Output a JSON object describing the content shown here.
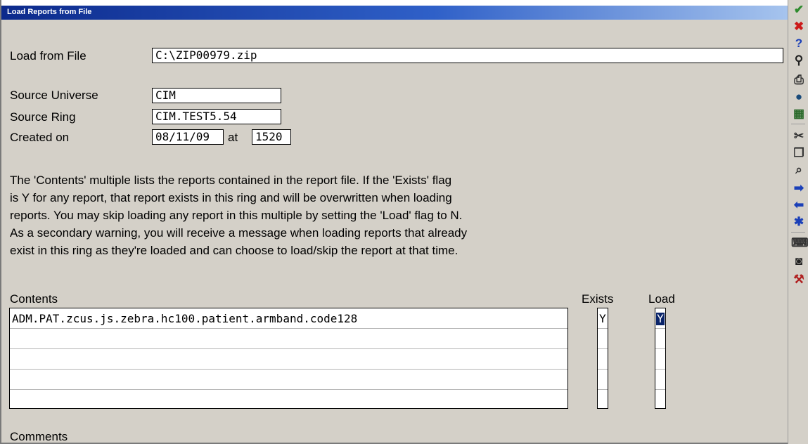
{
  "window": {
    "title": "Load Reports from File"
  },
  "form": {
    "load_from_file": {
      "label": "Load from File",
      "value": "C:\\ZIP00979.zip"
    },
    "source_universe": {
      "label": "Source Universe",
      "value": "CIM"
    },
    "source_ring": {
      "label": "Source Ring",
      "value": "CIM.TEST5.54"
    },
    "created_on": {
      "label": "Created on",
      "date": "08/11/09",
      "at_label": "at",
      "time": "1520"
    }
  },
  "description": [
    "The 'Contents' multiple lists the reports contained in the report file. If the 'Exists' flag",
    "is Y for any report, that report exists in this ring and will be overwritten when loading",
    "reports. You may skip loading any report in this multiple by setting the 'Load' flag to N.",
    "As a secondary warning, you will receive a message when loading reports that already",
    "exist in this ring as they're loaded and can choose to load/skip the report at that time."
  ],
  "contents": {
    "header": "Contents",
    "exists_header": "Exists",
    "load_header": "Load",
    "rows": [
      {
        "name": "ADM.PAT.zcus.js.zebra.hc100.patient.armband.code128",
        "exists": "Y",
        "load": "Y"
      },
      {
        "name": "",
        "exists": "",
        "load": ""
      },
      {
        "name": "",
        "exists": "",
        "load": ""
      },
      {
        "name": "",
        "exists": "",
        "load": ""
      },
      {
        "name": "",
        "exists": "",
        "load": ""
      }
    ]
  },
  "comments": {
    "label": "Comments"
  },
  "toolbar": [
    {
      "name": "ok-check-icon",
      "glyph": "✔",
      "color": "#2e8b2e"
    },
    {
      "name": "cancel-x-icon",
      "glyph": "✖",
      "color": "#cc1a1a"
    },
    {
      "name": "help-question-icon",
      "glyph": "?",
      "color": "#1a3fb8"
    },
    {
      "name": "binoculars-find-icon",
      "glyph": "⚲",
      "color": "#222222"
    },
    {
      "name": "print-help-icon",
      "glyph": "⎙",
      "color": "#333333"
    },
    {
      "name": "globe-icon",
      "glyph": "●",
      "color": "#1a4b7a"
    },
    {
      "name": "table-edit-icon",
      "glyph": "▦",
      "color": "#2a6a2a"
    },
    {
      "name": "cut-scissors-icon",
      "glyph": "✂",
      "color": "#333333"
    },
    {
      "name": "copy-icon",
      "glyph": "❐",
      "color": "#333333"
    },
    {
      "name": "paste-icon",
      "glyph": "⌕",
      "color": "#333333"
    },
    {
      "name": "arrow-right-icon",
      "glyph": "➡",
      "color": "#1a3fb8"
    },
    {
      "name": "arrow-left-icon",
      "glyph": "⬅",
      "color": "#1a3fb8"
    },
    {
      "name": "asterisk-icon",
      "glyph": "✱",
      "color": "#1a3fb8"
    },
    {
      "name": "keyboard-icon",
      "glyph": "⌨",
      "color": "#333333"
    },
    {
      "name": "camera-icon",
      "glyph": "◙",
      "color": "#222222"
    },
    {
      "name": "tools-icon",
      "glyph": "⚒",
      "color": "#b02020"
    }
  ]
}
